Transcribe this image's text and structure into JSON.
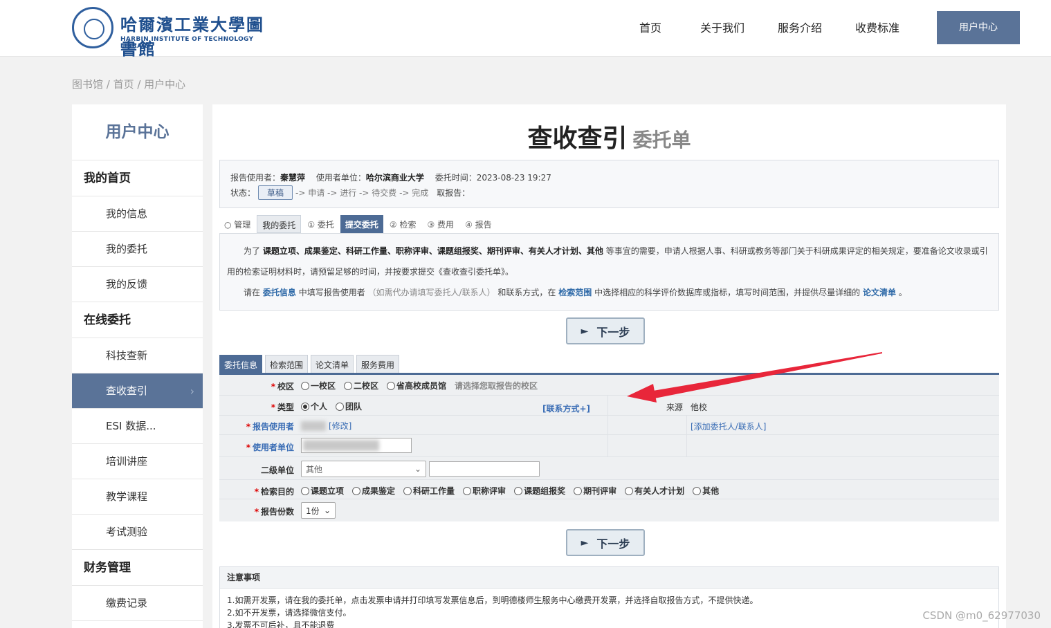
{
  "header": {
    "logo_cn": "哈爾濱工業大學圖書館",
    "logo_en": "HARBIN INSTITUTE OF TECHNOLOGY LIBRARY",
    "nav": [
      "首页",
      "关于我们",
      "服务介绍",
      "收费标准"
    ],
    "user_center_button": "用户中心"
  },
  "breadcrumb": "图书馆 / 首页 / 用户中心",
  "sidebar": {
    "title": "用户中心",
    "sections": [
      {
        "label": "我的首页",
        "items": [
          "我的信息",
          "我的委托",
          "我的反馈"
        ]
      },
      {
        "label": "在线委托",
        "items": [
          "科技查新",
          "查收查引",
          "ESI 数据...",
          "培训讲座",
          "教学课程",
          "考试测验"
        ]
      },
      {
        "label": "财务管理",
        "items": [
          "缴费记录"
        ]
      }
    ],
    "active_item": "查收查引"
  },
  "form": {
    "title_main": "查收查引",
    "title_sub": "委托单",
    "info": {
      "user_label": "报告使用者：",
      "user_value": "秦慧萍",
      "unit_label": "使用者单位：",
      "unit_value": "哈尔滨商业大学",
      "time_label": "委托时间：",
      "time_value": "2023-08-23 19:27",
      "status_label": "状态：",
      "status_value": "草稿",
      "flow": "-> 申请 -> 进行 -> 待交费 -> 完成",
      "report_label": "取报告："
    },
    "step_tabs": [
      "○ 管理",
      "我的委托",
      "① 委托",
      "提交委托",
      "② 检索",
      "③ 费用",
      "④ 报告"
    ],
    "description": {
      "p1_prefix": "为了",
      "p1_bold": "课题立项、成果鉴定、科研工作量、职称评审、课题组报奖、期刊评审、有关人才计划、其他",
      "p1_suffix": "等事宜的需要，申请人根据人事、科研或教务等部门关于科研成果评定的相关规定，要准备论文收录或引",
      "p1_line2": "用的检索证明材料时，请预留足够的时间，并按要求提交《查收查引委托单》。",
      "p2_a": "请在",
      "p2_link1": "委托信息",
      "p2_b": "中填写报告使用者",
      "p2_gray": "（如需代办请填写委托人/联系人）",
      "p2_c": "和联系方式，在",
      "p2_link2": "检索范围",
      "p2_d": "中选择相应的科学评价数据库或指标，填写时间范围，并提供尽量详细的",
      "p2_link3": "论文清单",
      "p2_e": "。"
    },
    "next_button": "下一步",
    "form_tabs": [
      "委托信息",
      "检索范围",
      "论文清单",
      "服务费用"
    ],
    "fields": {
      "campus_label": "校区",
      "campus_options": [
        "一校区",
        "二校区",
        "省高校成员馆"
      ],
      "campus_hint": "请选择您取报告的校区",
      "type_label": "类型",
      "type_options": [
        "个人",
        "团队"
      ],
      "type_selected": "个人",
      "contact_link": "[联系方式+]",
      "source_label": "来源",
      "source_value": "他校",
      "user_label": "报告使用者",
      "modify_link": "[修改]",
      "add_contact_link": "[添加委托人/联系人]",
      "unit_label": "使用者单位",
      "subunit_label": "二级单位",
      "subunit_value": "其他",
      "purpose_label": "检索目的",
      "purpose_options": [
        "课题立项",
        "成果鉴定",
        "科研工作量",
        "职称评审",
        "课题组报奖",
        "期刊评审",
        "有关人才计划",
        "其他"
      ],
      "copies_label": "报告份数",
      "copies_value": "1份"
    },
    "notes": {
      "title": "注意事项",
      "lines": [
        "1.如需开发票，请在我的委托单，点击发票申请并打印填写发票信息后，到明德楼师生服务中心缴费开发票，并选择自取报告方式，不提供快递。",
        "2.如不开发票，请选择微信支付。",
        "3.发票不可后补，且不能退费"
      ]
    }
  },
  "watermark": "CSDN @m0_62977030",
  "colors": {
    "accent": "#5a7398",
    "tab_primary": "#4d6b95",
    "annotation_arrow": "#e8263a"
  }
}
